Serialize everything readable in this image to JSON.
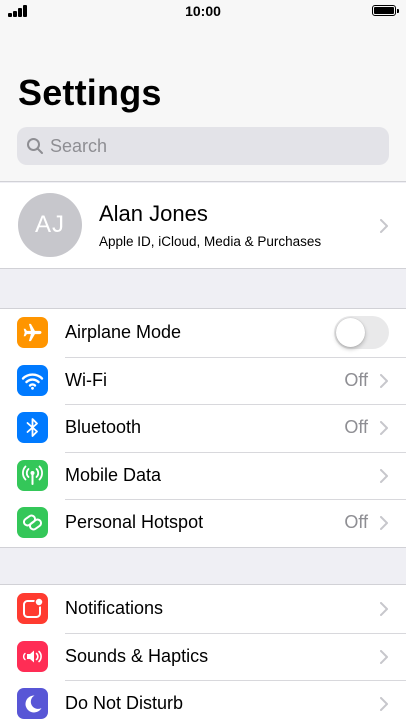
{
  "status_bar": {
    "time": "10:00"
  },
  "header": {
    "title": "Settings"
  },
  "search": {
    "placeholder": "Search"
  },
  "profile": {
    "initials": "AJ",
    "name": "Alan Jones",
    "subtitle": "Apple ID, iCloud, Media & Purchases"
  },
  "connectivity": {
    "items": [
      {
        "label": "Airplane Mode",
        "icon": "airplane-icon",
        "color": "#ff9500",
        "toggle": false
      },
      {
        "label": "Wi-Fi",
        "icon": "wifi-icon",
        "color": "#007aff",
        "value": "Off"
      },
      {
        "label": "Bluetooth",
        "icon": "bluetooth-icon",
        "color": "#007aff",
        "value": "Off"
      },
      {
        "label": "Mobile Data",
        "icon": "antenna-icon",
        "color": "#34c759"
      },
      {
        "label": "Personal Hotspot",
        "icon": "hotspot-icon",
        "color": "#34c759",
        "value": "Off"
      }
    ]
  },
  "system": {
    "items": [
      {
        "label": "Notifications",
        "icon": "notifications-icon",
        "color": "#ff3b30"
      },
      {
        "label": "Sounds & Haptics",
        "icon": "speaker-icon",
        "color": "#ff2d55"
      },
      {
        "label": "Do Not Disturb",
        "icon": "moon-icon",
        "color": "#5856d6"
      }
    ]
  }
}
